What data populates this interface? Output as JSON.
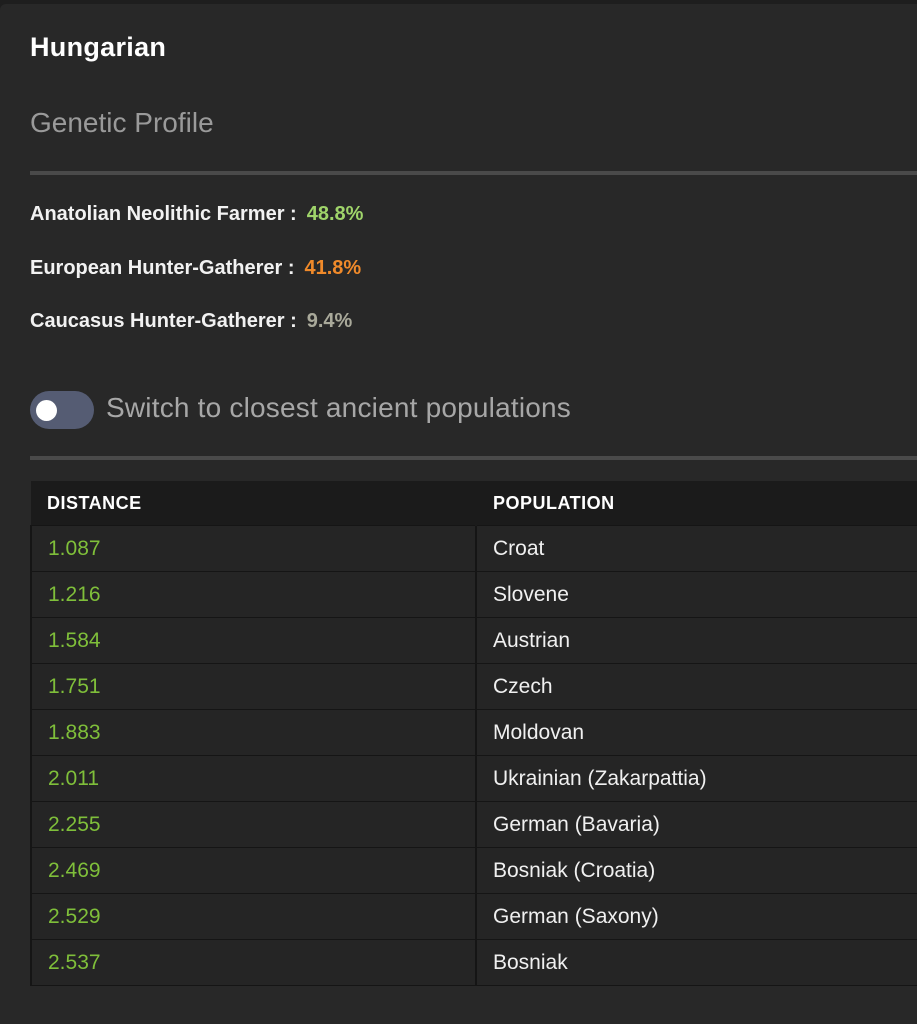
{
  "header": {
    "title": "Hungarian",
    "subtitle": "Genetic Profile"
  },
  "components": [
    {
      "label": "Anatolian Neolithic Farmer :",
      "value": "48.8%",
      "color": "#9fd46a"
    },
    {
      "label": "European Hunter-Gatherer :",
      "value": "41.8%",
      "color": "#f08a2a"
    },
    {
      "label": "Caucasus Hunter-Gatherer :",
      "value": "9.4%",
      "color": "#a9a99a"
    }
  ],
  "toggle": {
    "label": "Switch to closest ancient populations",
    "state": "off"
  },
  "table": {
    "headers": [
      "DISTANCE",
      "POPULATION"
    ],
    "rows": [
      {
        "distance": "1.087",
        "population": "Croat"
      },
      {
        "distance": "1.216",
        "population": "Slovene"
      },
      {
        "distance": "1.584",
        "population": "Austrian"
      },
      {
        "distance": "1.751",
        "population": "Czech"
      },
      {
        "distance": "1.883",
        "population": "Moldovan"
      },
      {
        "distance": "2.011",
        "population": "Ukrainian (Zakarpattia)"
      },
      {
        "distance": "2.255",
        "population": "German (Bavaria)"
      },
      {
        "distance": "2.469",
        "population": "Bosniak (Croatia)"
      },
      {
        "distance": "2.529",
        "population": "German (Saxony)"
      },
      {
        "distance": "2.537",
        "population": "Bosniak"
      }
    ]
  }
}
